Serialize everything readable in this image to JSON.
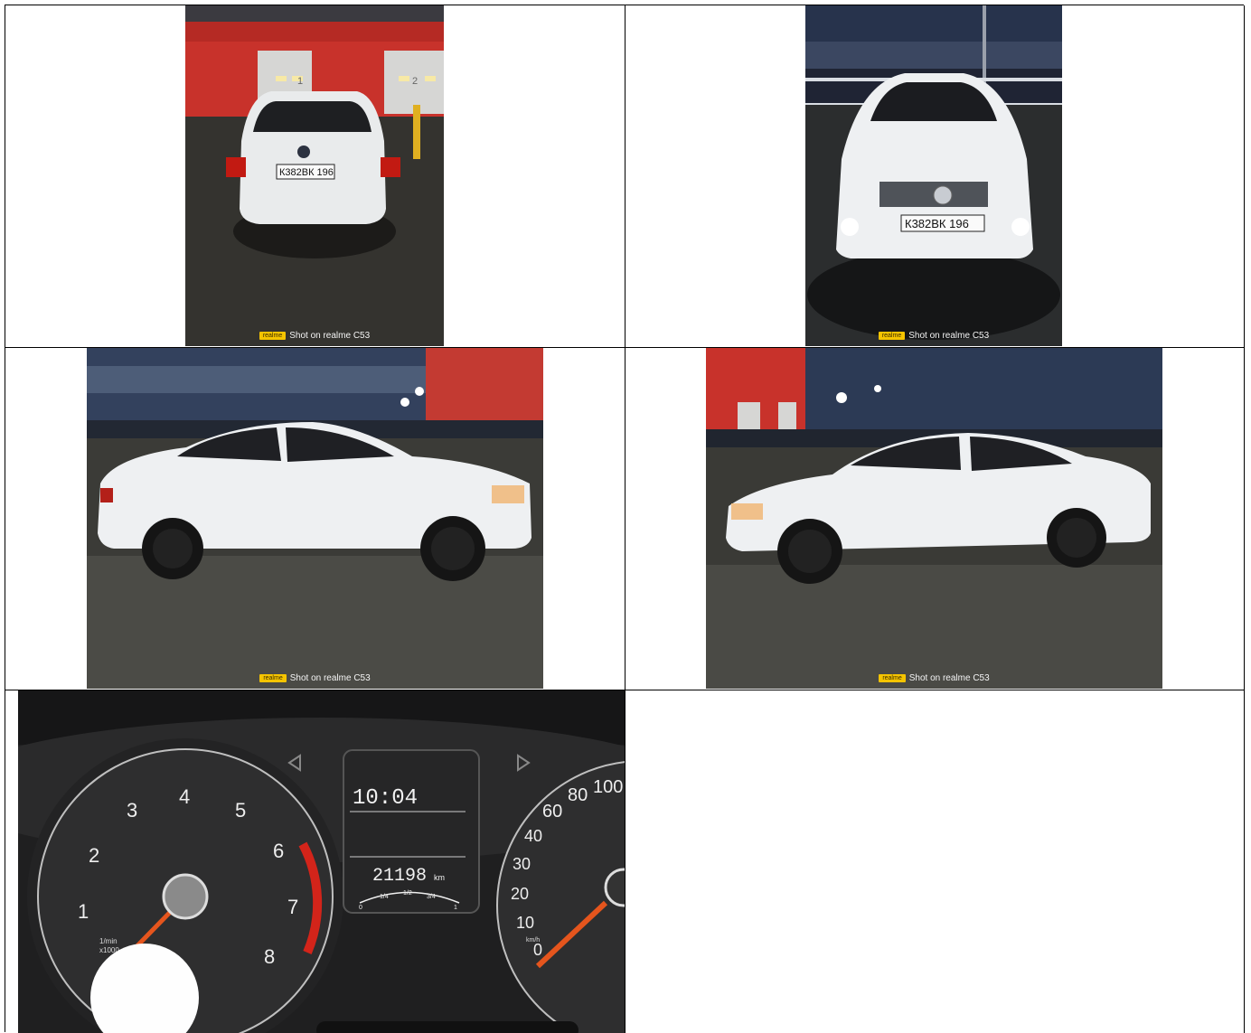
{
  "watermark": {
    "brand": "realme",
    "caption": "Shot on realme C53"
  },
  "plates": {
    "rear": "К382ВК 196",
    "front": "К382ВК 196"
  },
  "garage_bays": [
    "1",
    "2"
  ],
  "dashboard": {
    "clock": "10:04",
    "odometer": "21198",
    "odometer_unit": "km",
    "fuel_labels": [
      "0",
      "1/4",
      "1/2",
      "3/4",
      "1"
    ],
    "tach_numbers": [
      "1",
      "2",
      "3",
      "4",
      "5",
      "6",
      "7",
      "8"
    ],
    "tach_unit_line1": "1/min",
    "tach_unit_line2": "x1000",
    "speed_numbers": [
      "0",
      "10",
      "20",
      "30",
      "40",
      "60",
      "80",
      "100"
    ],
    "speed_unit": "km/h"
  },
  "colors": {
    "wall_red": "#c8322b",
    "car_white": "#eef0f2",
    "sky_dusk": "#2a3650",
    "needle_orange": "#e5551d"
  }
}
